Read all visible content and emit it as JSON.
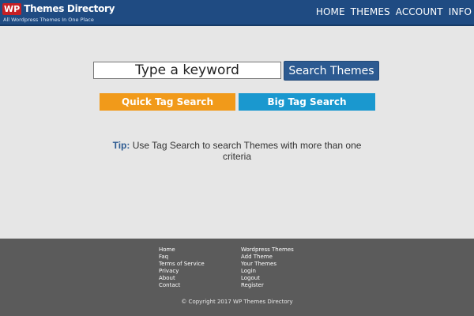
{
  "header": {
    "logo_wp": "WP",
    "logo_name": "Themes Directory",
    "logo_tagline": "All Wordpress Themes In One Place",
    "nav": [
      "HOME",
      "THEMES",
      "ACCOUNT",
      "INFO"
    ]
  },
  "search": {
    "placeholder": "Type a keyword",
    "button_label": "Search Themes"
  },
  "tag_buttons": {
    "quick": "Quick Tag Search",
    "big": "Big Tag Search"
  },
  "tip": {
    "label": "Tip:",
    "text": "Use Tag Search to search Themes with more than one criteria"
  },
  "footer": {
    "col1": [
      "Home",
      "Faq",
      "Terms of Service",
      "Privacy",
      "About",
      "Contact"
    ],
    "col2": [
      "Wordpress Themes",
      "Add Theme",
      "Your Themes",
      "Login",
      "Logout",
      "Register"
    ],
    "copyright": "© Copyright 2017 WP Themes Directory"
  },
  "colors": {
    "header_bg": "#1f4b82",
    "accent_orange": "#f19a1a",
    "accent_blue": "#1a98cf",
    "footer_bg": "#5b5b5b"
  }
}
